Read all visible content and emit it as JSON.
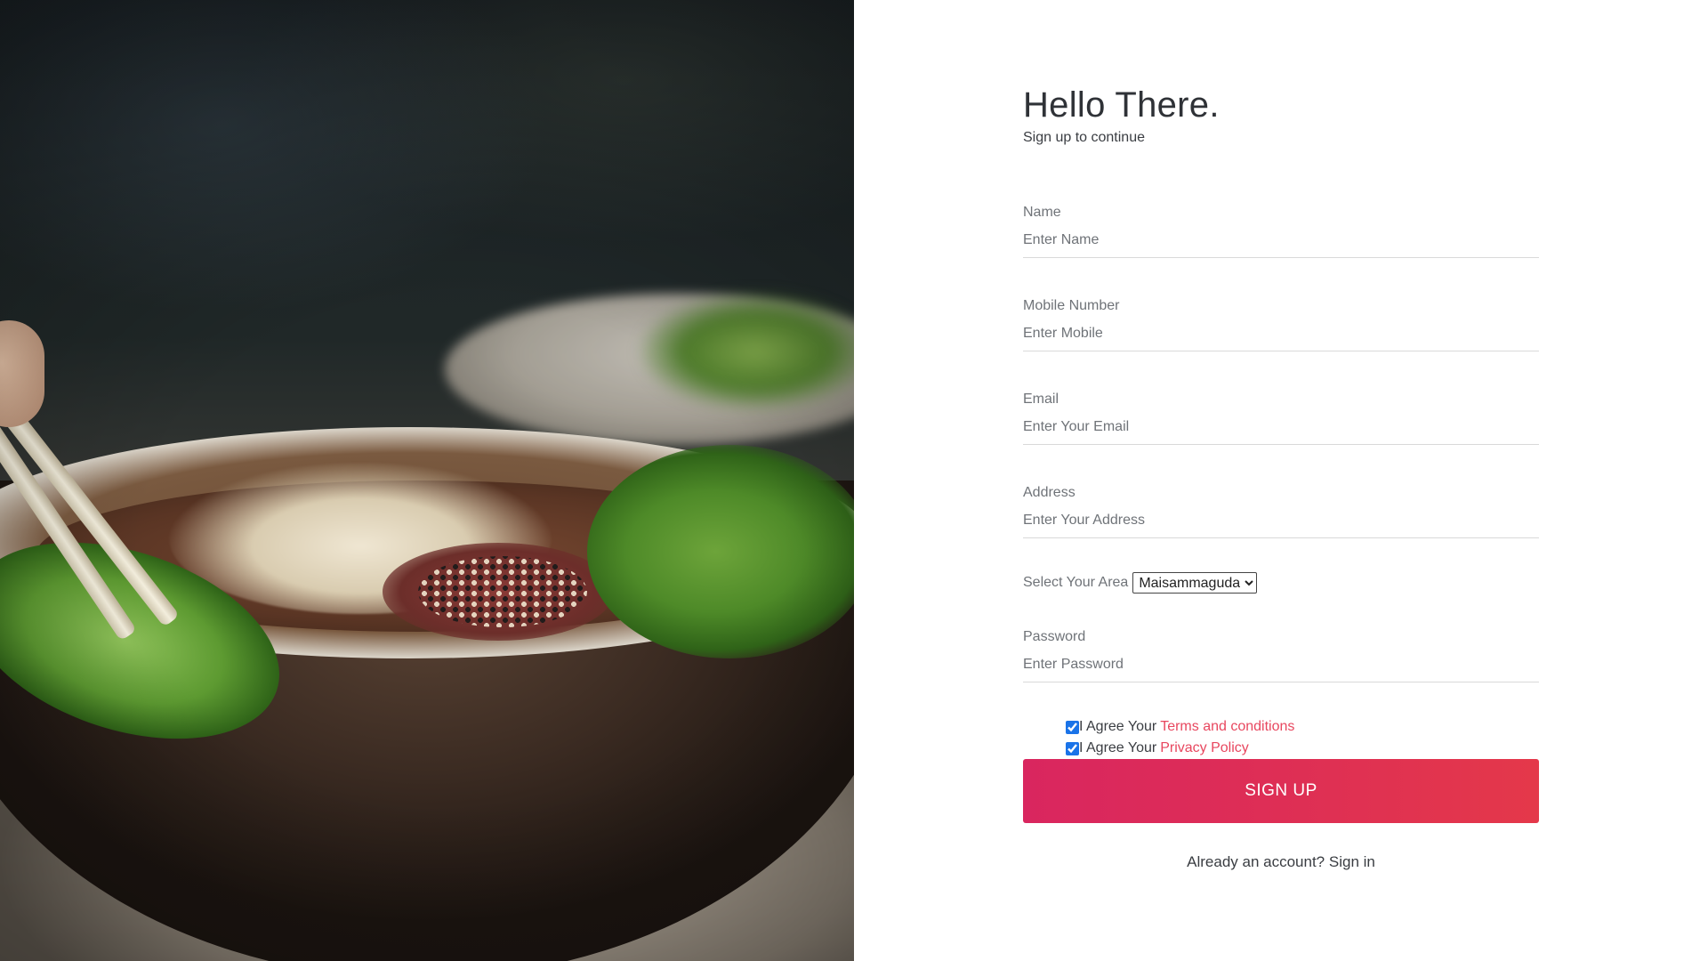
{
  "hero": {
    "image": "bowl-of-pho-with-chopsticks-and-herbs"
  },
  "form": {
    "title": "Hello There.",
    "subtitle": "Sign up to continue",
    "name": {
      "label": "Name",
      "placeholder": "Enter Name"
    },
    "mobile": {
      "label": "Mobile Number",
      "placeholder": "Enter Mobile"
    },
    "email": {
      "label": "Email",
      "placeholder": "Enter Your Email"
    },
    "address": {
      "label": "Address",
      "placeholder": "Enter Your Address"
    },
    "area": {
      "label": "Select Your Area",
      "selected": "Maisammaguda"
    },
    "password": {
      "label": "Password",
      "placeholder": "Enter Password"
    },
    "agreements": [
      {
        "prefix": "I Agree Your",
        "link": "Terms and conditions",
        "checked": true
      },
      {
        "prefix": "I Agree Your",
        "link": "Privacy Policy",
        "checked": true
      }
    ],
    "submit_label": "SIGN UP",
    "signin_prompt": "Already an account?",
    "signin_link": "Sign in"
  },
  "colors": {
    "accent": "#e8475f",
    "button_start": "#d9265f",
    "button_end": "#e4384a",
    "text": "#3a3d42",
    "muted": "#6f7378"
  }
}
